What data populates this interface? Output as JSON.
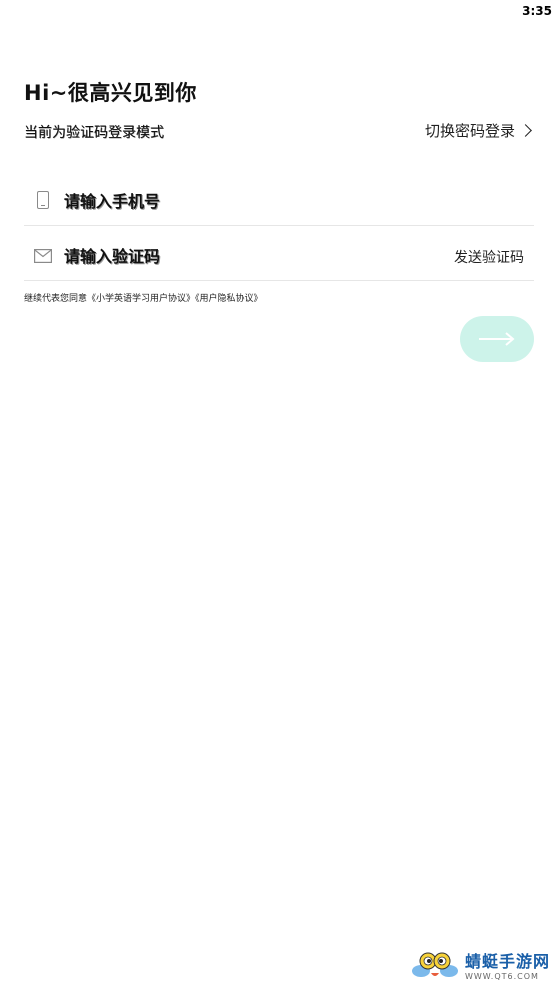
{
  "status_bar": {
    "time": "3:35"
  },
  "header": {
    "greeting": "Hi~很高兴见到你"
  },
  "mode": {
    "label": "当前为验证码登录模式",
    "switch_label": "切换密码登录"
  },
  "form": {
    "phone": {
      "value": "",
      "placeholder": "请输入手机号",
      "icon": "phone-icon"
    },
    "code": {
      "value": "",
      "placeholder": "请输入验证码",
      "icon": "mail-icon",
      "send_label": "发送验证码"
    }
  },
  "agreement": {
    "prefix": "继续代表您同意",
    "user_agreement": "《小学英语学习用户协议》",
    "privacy_agreement": "《用户隐私协议》"
  },
  "submit": {
    "icon": "arrow-right-icon",
    "color": "#cdf3ea"
  },
  "watermark": {
    "title": "蜻蜓手游网",
    "url": "WWW.QT6.COM"
  }
}
